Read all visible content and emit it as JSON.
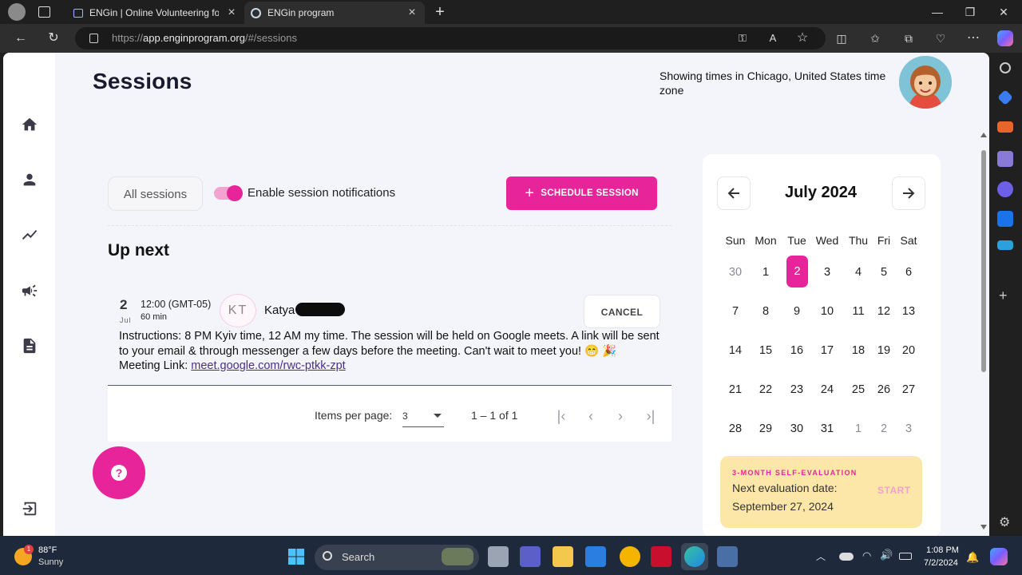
{
  "browser": {
    "tabs": [
      {
        "label": "ENGin | Online Volunteering for U"
      },
      {
        "label": "ENGin program"
      }
    ],
    "url_prefix": "https://",
    "url_host": "app.enginprogram.org",
    "url_path": "/#/sessions"
  },
  "page": {
    "title": "Sessions",
    "timezone_note": "Showing times in Chicago, United States time zone"
  },
  "toolbar": {
    "all_sessions_label": "All sessions",
    "notifications_label": "Enable session notifications",
    "notifications_enabled": true,
    "schedule_button_label": "SCHEDULE SESSION"
  },
  "up_next": {
    "heading": "Up next",
    "session": {
      "day": "2",
      "month": "Jul",
      "time": "12:00 (GMT-05)",
      "duration": "60 min",
      "initials": "KT",
      "volunteer_name": "Katya",
      "cancel_label": "CANCEL",
      "instructions": "Instructions: 8 PM Kyiv time, 12 AM my time. The session will be held on Google meets. A link will be sent to your email & through messenger a few days before the meeting. Can't wait to meet you! 😁 🎉",
      "meeting_label": "Meeting Link:",
      "meeting_link": "meet.google.com/rwc-ptkk-zpt"
    }
  },
  "pagination": {
    "items_per_page_label": "Items per page:",
    "items_per_page_value": "3",
    "range_label": "1 – 1 of 1"
  },
  "calendar": {
    "month_label": "July 2024",
    "weekdays": [
      "Sun",
      "Mon",
      "Tue",
      "Wed",
      "Thu",
      "Fri",
      "Sat"
    ],
    "weeks": [
      [
        {
          "d": "30",
          "m": true
        },
        {
          "d": "1"
        },
        {
          "d": "2",
          "s": true
        },
        {
          "d": "3"
        },
        {
          "d": "4"
        },
        {
          "d": "5"
        },
        {
          "d": "6"
        }
      ],
      [
        {
          "d": "7"
        },
        {
          "d": "8"
        },
        {
          "d": "9"
        },
        {
          "d": "10"
        },
        {
          "d": "11"
        },
        {
          "d": "12"
        },
        {
          "d": "13"
        }
      ],
      [
        {
          "d": "14"
        },
        {
          "d": "15"
        },
        {
          "d": "16"
        },
        {
          "d": "17"
        },
        {
          "d": "18"
        },
        {
          "d": "19"
        },
        {
          "d": "20"
        }
      ],
      [
        {
          "d": "21"
        },
        {
          "d": "22"
        },
        {
          "d": "23"
        },
        {
          "d": "24"
        },
        {
          "d": "25"
        },
        {
          "d": "26"
        },
        {
          "d": "27"
        }
      ],
      [
        {
          "d": "28"
        },
        {
          "d": "29"
        },
        {
          "d": "30"
        },
        {
          "d": "31"
        },
        {
          "d": "1",
          "m": true
        },
        {
          "d": "2",
          "m": true
        },
        {
          "d": "3",
          "m": true
        }
      ]
    ]
  },
  "evaluation": {
    "heading": "3-MONTH SELF-EVALUATION",
    "line1": "Next evaluation date:",
    "line2": "September 27, 2024",
    "start_label": "START"
  },
  "taskbar": {
    "temperature": "88°F",
    "condition": "Sunny",
    "search_label": "Search",
    "time": "1:08 PM",
    "date": "7/2/2024"
  },
  "colors": {
    "accent": "#e8249a",
    "eval_bg": "#fce7a8"
  }
}
